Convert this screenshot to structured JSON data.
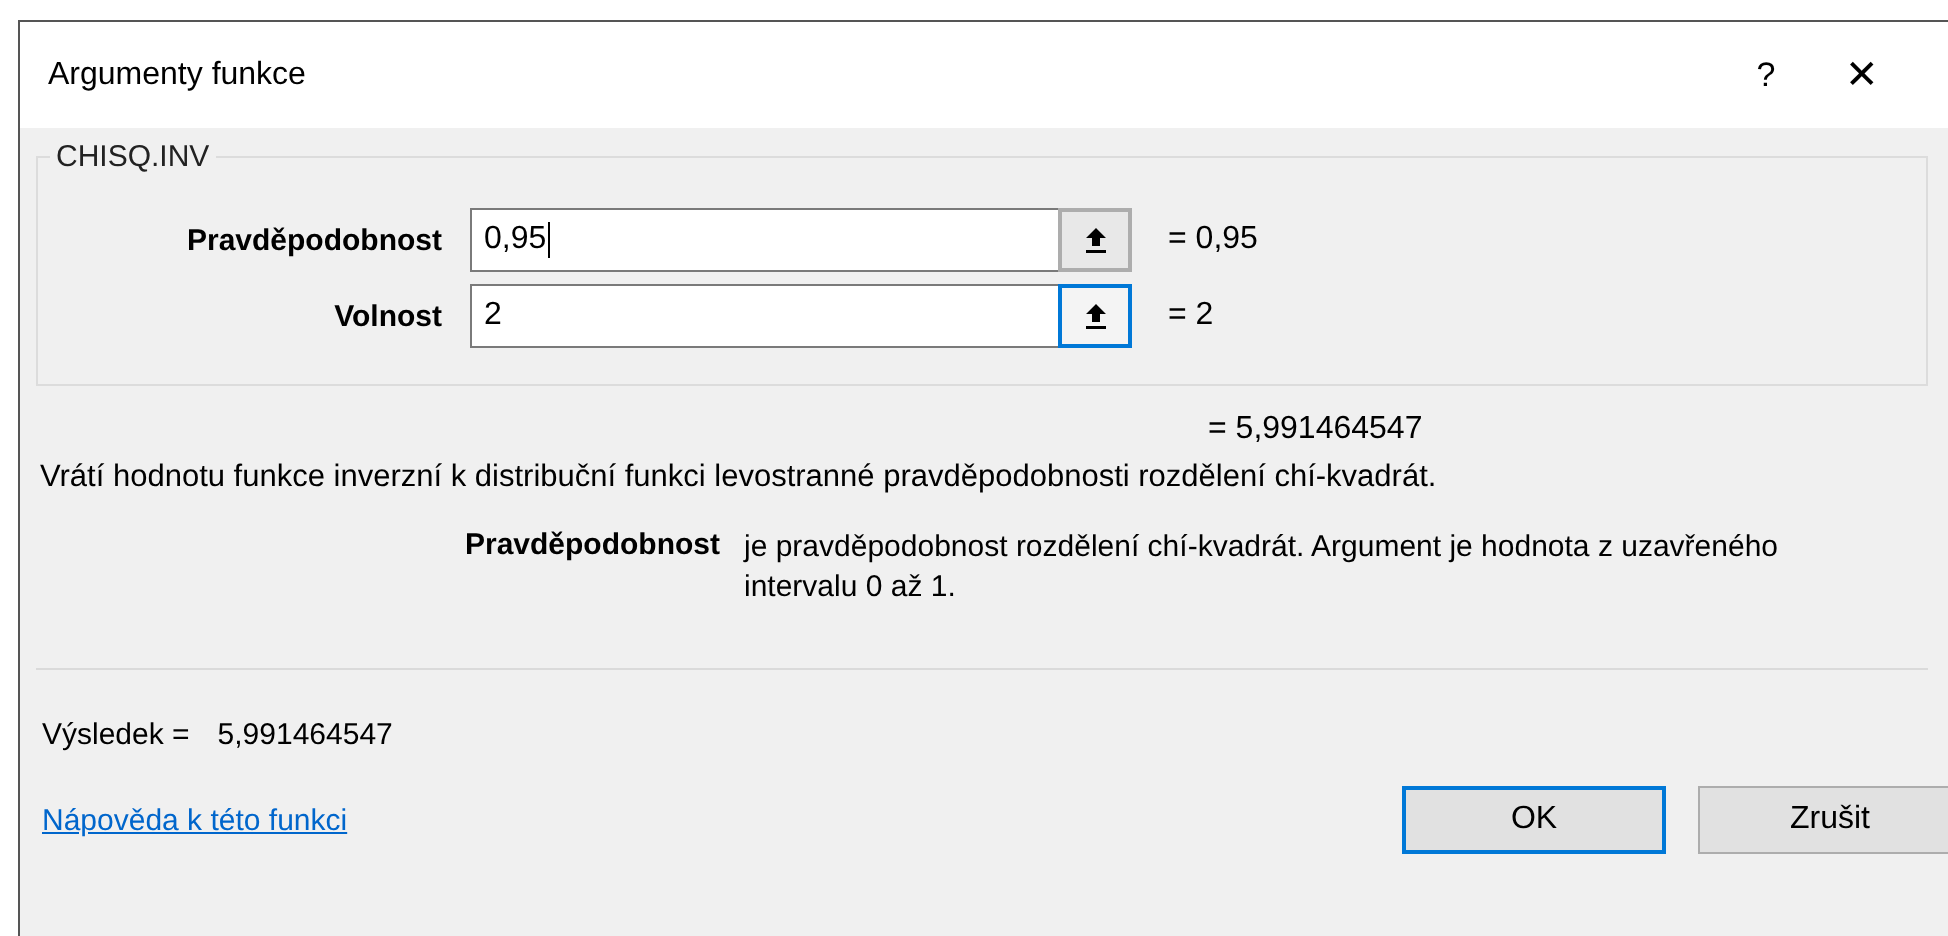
{
  "window": {
    "title": "Argumenty funkce",
    "help": "?",
    "close": "✕"
  },
  "function_name": "CHISQ.INV",
  "arguments": [
    {
      "label": "Pravděpodobnost",
      "value": "0,95",
      "result": "= 0,95",
      "focused": true
    },
    {
      "label": "Volnost",
      "value": "2",
      "result": "= 2",
      "focused": false
    }
  ],
  "formula_result": "= 5,991464547",
  "description": "Vrátí hodnotu funkce inverzní k distribuční funkci levostranné pravděpodobnosti rozdělení chí-kvadrát.",
  "argument_help": {
    "label": "Pravděpodobnost",
    "text": "je pravděpodobnost rozdělení chí-kvadrát. Argument je hodnota z uzavřeného intervalu 0 až 1."
  },
  "result": {
    "label": "Výsledek =",
    "value": "5,991464547"
  },
  "help_link": "Nápověda k této funkci",
  "buttons": [
    {
      "label": "OK",
      "default": true
    },
    {
      "label": "Zrušit",
      "default": false
    }
  ]
}
